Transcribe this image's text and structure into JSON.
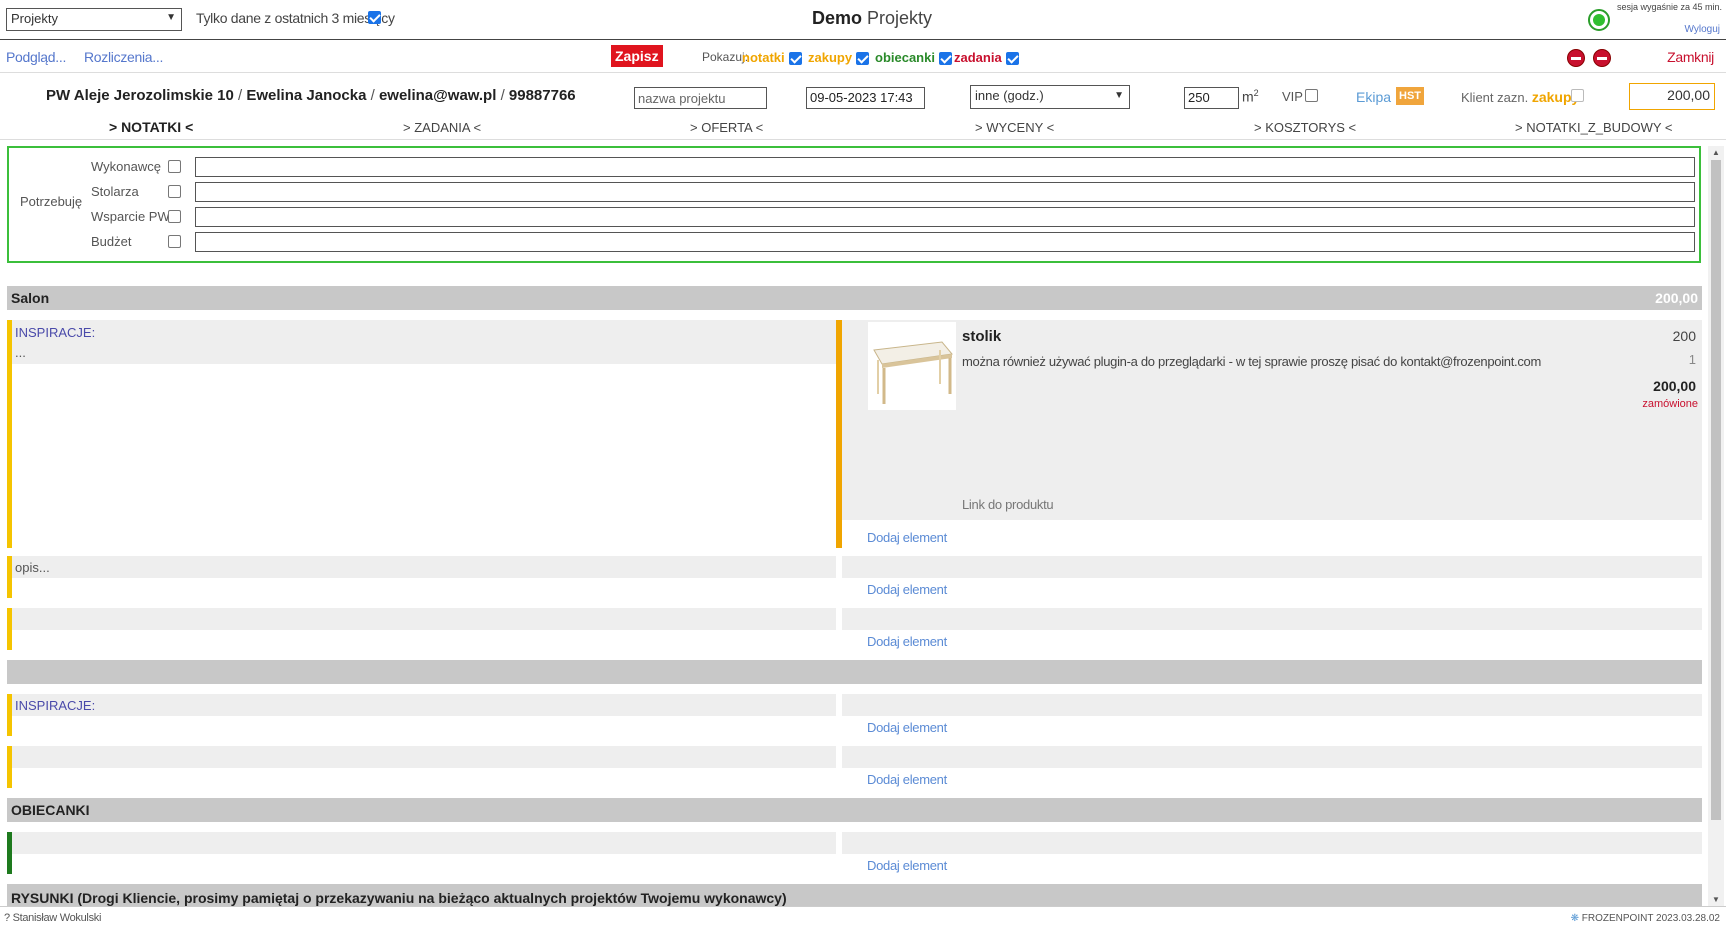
{
  "topbar": {
    "module_select": "Projekty",
    "recent_label": "Tylko dane z ostatnich 3 miesięcy",
    "title_bold": "Demo",
    "title_rest": "Projekty",
    "session_text": "sesja wygaśnie za 45 min.",
    "logout": "Wyloguj"
  },
  "bar2": {
    "preview": "Podgląd...",
    "settlements": "Rozliczenia...",
    "save": "Zapisz",
    "show_label": "Pokazuj:",
    "filters": {
      "notes": "notatki",
      "purchases": "zakupy",
      "promises": "obiecanki",
      "tasks": "zadania"
    },
    "close": "Zamknij"
  },
  "project": {
    "address": "PW Aleje Jerozolimskie 10",
    "client": "Ewelina Janocka",
    "email": "ewelina@waw.pl",
    "phone": "99887766",
    "sep": "/",
    "name_placeholder": "nazwa projektu",
    "date": "09-05-2023 17:43",
    "type": "inne (godz.)",
    "area": "250",
    "area_unit": "m",
    "area_sup": "2",
    "vip": "VIP",
    "crew": "Ekipa",
    "hst": "HST",
    "client_marked": "Klient zazn.",
    "client_marked_bold": "zakupy",
    "total": "200,00"
  },
  "tabs": [
    "> NOTATKI <",
    "> ZADANIA <",
    "> OFERTA <",
    "> WYCENY <",
    "> KOSZTORYS <",
    "> NOTATKI_Z_BUDOWY <"
  ],
  "needs": {
    "title": "Potrzebuję",
    "items": [
      "Wykonawcę",
      "Stolarza",
      "Wsparcie PW",
      "Budżet"
    ]
  },
  "content": {
    "salon": {
      "title": "Salon",
      "value": "200,00"
    },
    "inspiration": "INSPIRACJE:",
    "dots": "...",
    "opis": "opis...",
    "add_element": "Dodaj element",
    "product": {
      "name": "stolik",
      "desc": "można również używać plugin-a do przeglądarki - w tej sprawie proszę pisać do kontakt@frozenpoint.com",
      "price": "200",
      "qty": "1",
      "total": "200,00",
      "status": "zamówione",
      "link": "Link do produktu"
    },
    "promises": {
      "title": "OBIECANKI"
    },
    "drawings": {
      "title": "RYSUNKI (Drogi Kliencie, prosimy pamiętaj o przekazywaniu na bieżąco aktualnych projektów Twojemu wykonawcy)"
    }
  },
  "footer": {
    "user": "? Stanisław Wokulski",
    "brand": "FROZENPOINT 2023.03.28.02"
  },
  "colors": {
    "accent_orange": "#f0a500",
    "save_red": "#e0141e",
    "promise_green": "#2a8a2a",
    "needs_border": "#3bbf3b",
    "note_yellow": "#f5c400"
  }
}
